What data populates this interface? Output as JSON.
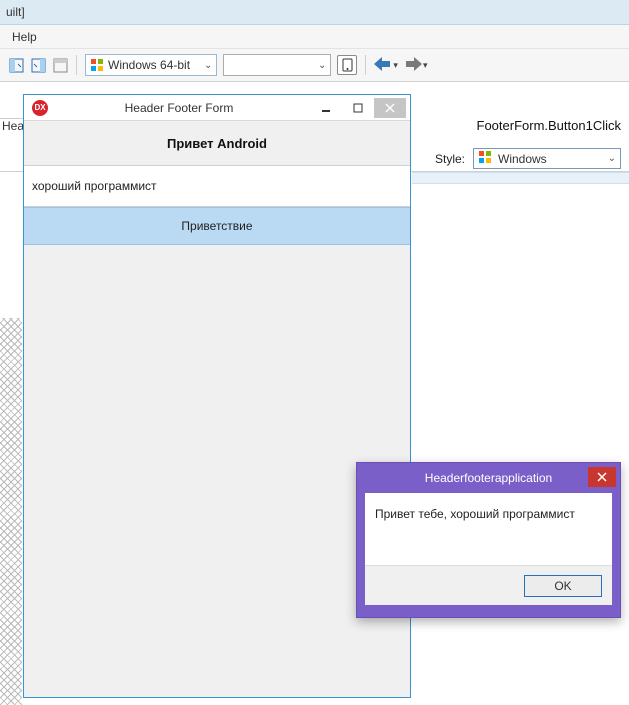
{
  "topbar": {
    "build_label": "uilt]"
  },
  "menu": {
    "help": "Help"
  },
  "toolbar": {
    "platform": "Windows 64-bit",
    "back_chevron": "▾",
    "fwd_chevron": "▾"
  },
  "context": {
    "left_tab": "Hea",
    "function": "FooterForm.Button1Click",
    "style_label": "Style:",
    "style_value": "Windows"
  },
  "app_window": {
    "title": "Header Footer Form",
    "header": "Привет Android",
    "input_value": "хороший программист",
    "button": "Приветствие"
  },
  "dialog": {
    "title": "Headerfooterapplication",
    "message": "Привет тебе, хороший программист",
    "ok": "OK"
  }
}
